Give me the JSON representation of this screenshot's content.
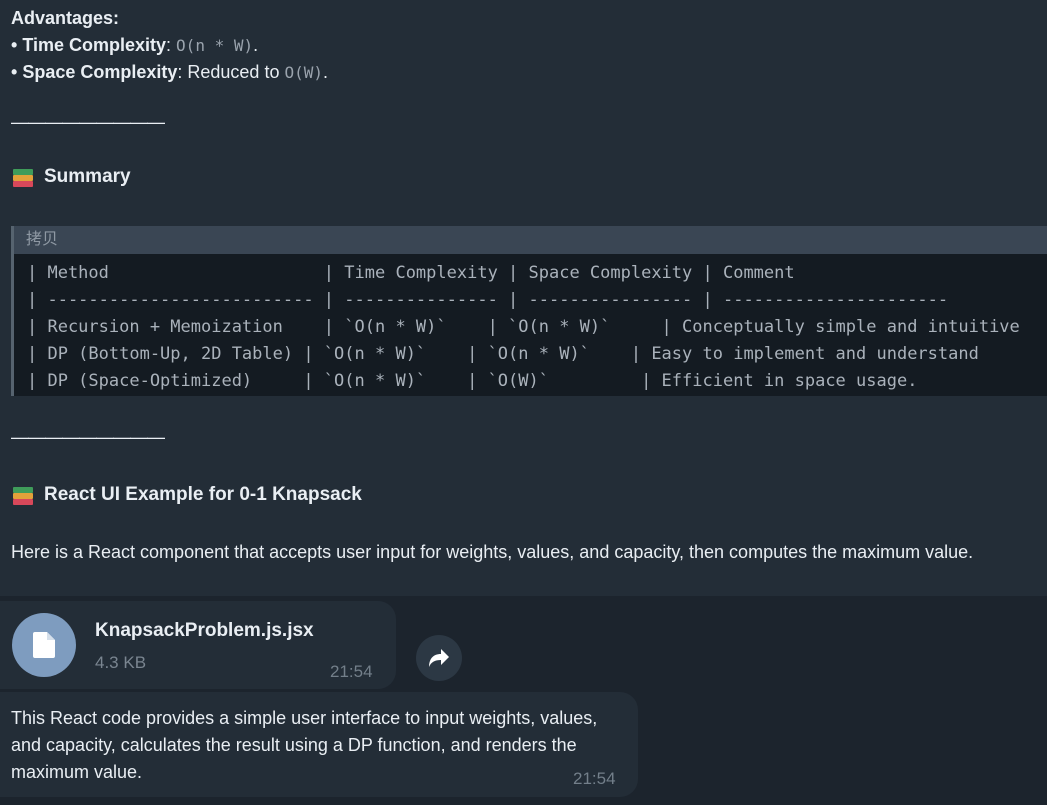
{
  "advantages": {
    "heading": "Advantages:",
    "time_label": "Time Complexity",
    "time_value": "O(n * W)",
    "space_label": "Space Complexity",
    "space_prefix": "Reduced to",
    "space_value": "O(W)"
  },
  "divider": "—————————",
  "summary": {
    "heading": "Summary"
  },
  "code_block": {
    "header": "拷贝",
    "lines": [
      "| Method                     | Time Complexity | Space Complexity | Comment",
      "| -------------------------- | --------------- | ---------------- | ----------------------",
      "| Recursion + Memoization    | `O(n * W)`    | `O(n * W)`     | Conceptually simple and intuitive",
      "| DP (Bottom-Up, 2D Table) | `O(n * W)`    | `O(n * W)`    | Easy to implement and understand",
      "| DP (Space-Optimized)     | `O(n * W)`    | `O(W)`         | Efficient in space usage."
    ]
  },
  "react_section": {
    "heading": "React UI Example for 0-1 Knapsack",
    "intro": "Here is a React component that accepts user input for weights, values, and capacity, then computes the maximum value."
  },
  "file_message": {
    "file_name": "KnapsackProblem.js.jsx",
    "file_size": "4.3 KB",
    "time": "21:54",
    "icon": "document-icon"
  },
  "text_message": {
    "text": "This React code provides a simple user interface to input weights, values, and capacity, calculates the result using a DP function, and renders the maximum value.",
    "time": "21:54"
  },
  "colors": {
    "chat_bg": "#1c242d",
    "bubble_bg": "#232d37",
    "accent": "#7e9cbf"
  }
}
